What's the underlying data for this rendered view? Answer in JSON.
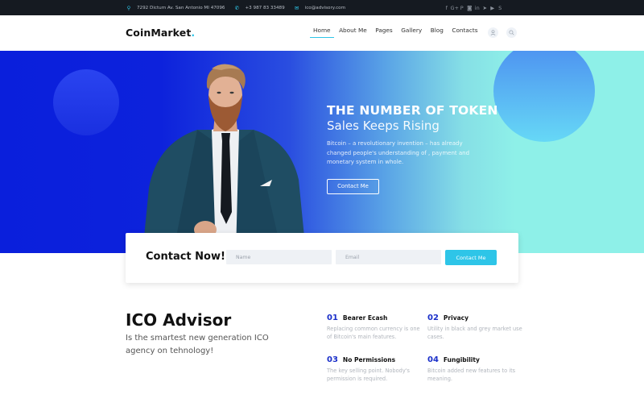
{
  "topbar": {
    "address": "7292 Dictum Av. San Antonio MI 47096",
    "phone": "+3 987 83 33489",
    "email": "ico@advisory.com",
    "social": [
      {
        "name": "facebook-icon",
        "glyph": "f"
      },
      {
        "name": "google-plus-icon",
        "glyph": "G+"
      },
      {
        "name": "pinterest-icon",
        "glyph": "P"
      },
      {
        "name": "instagram-icon",
        "glyph": "◙"
      },
      {
        "name": "linkedin-icon",
        "glyph": "in"
      },
      {
        "name": "telegram-icon",
        "glyph": "➤"
      },
      {
        "name": "youtube-icon",
        "glyph": "▶"
      },
      {
        "name": "skype-icon",
        "glyph": "S"
      }
    ]
  },
  "header": {
    "logo": "CoinMarket",
    "logo_dot": ".",
    "nav": [
      "Home",
      "About Me",
      "Pages",
      "Gallery",
      "Blog",
      "Contacts"
    ],
    "active_nav": "Home"
  },
  "hero": {
    "title": "THE NUMBER OF TOKEN",
    "subtitle": "Sales Keeps Rising",
    "description": "Bitcoin – a revolutionary invention – has already changed people's understanding of , payment and monetary system in whole.",
    "button": "Contact Me"
  },
  "contact": {
    "title": "Contact Now!",
    "name_placeholder": "Name",
    "email_placeholder": "Email",
    "button": "Contact Me"
  },
  "advisor": {
    "title": "ICO Advisor",
    "subtitle": "Is the smartest new generation ICO agency on tehnology!",
    "features": [
      {
        "num": "01",
        "name": "Bearer Ecash",
        "desc": "Replacing common currency is one of Bitcoin's main features."
      },
      {
        "num": "02",
        "name": "Privacy",
        "desc": "Utility in black and grey market use cases."
      },
      {
        "num": "03",
        "name": "No Permissions",
        "desc": "The key selling point. Nobody's permission is required."
      },
      {
        "num": "04",
        "name": "Fungibility",
        "desc": "Bitcoin added new features to its meaning."
      }
    ]
  },
  "colors": {
    "accent": "#2ec5e8",
    "number_blue": "#1a2fc9",
    "hero_start": "#0a1fdc",
    "hero_end": "#8ef0e8",
    "topbar_bg": "#151a21"
  }
}
